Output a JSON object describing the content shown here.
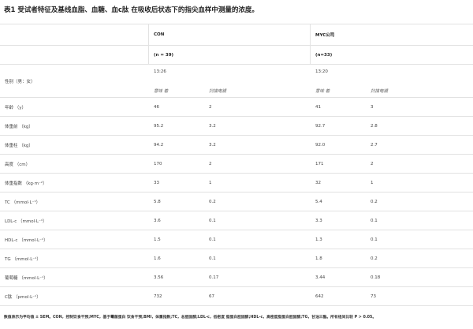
{
  "title": "表1  受试者特征及基线血脂、血糖、血c肽 在吸收后状态下的指尖血样中测量的浓度。",
  "groups": {
    "con": "CON",
    "myc": "MYC公司"
  },
  "n": {
    "con": "(n = 39)",
    "myc": "(n=33)"
  },
  "sex": {
    "label": "性别（男：女）",
    "con": "13:26",
    "myc": "13:20"
  },
  "subheaders": {
    "mean": "意味 着",
    "sem": "扫描电镜"
  },
  "rows": [
    {
      "label": "年龄 （y）",
      "con_mean": "46",
      "con_sem": "2",
      "myc_mean": "41",
      "myc_sem": "3"
    },
    {
      "label": "体重前 （kg）",
      "con_mean": "95.2",
      "con_sem": "3.2",
      "myc_mean": "92.7",
      "myc_sem": "2.8"
    },
    {
      "label": "体重柱 （kg）",
      "con_mean": "94.2",
      "con_sem": "3.2",
      "myc_mean": "92.0",
      "myc_sem": "2.7"
    },
    {
      "label": "高度 （cm）",
      "con_mean": "170",
      "con_sem": "2",
      "myc_mean": "171",
      "myc_sem": "2"
    },
    {
      "label": "体重指数 （kg·m⁻²）",
      "con_mean": "33",
      "con_sem": "1",
      "myc_mean": "32",
      "myc_sem": "1"
    },
    {
      "label": "TC （mmol·L⁻¹）",
      "con_mean": "5.8",
      "con_sem": "0.2",
      "myc_mean": "5.4",
      "myc_sem": "0.2"
    },
    {
      "label": "LDL-c （mmol·L⁻¹）",
      "con_mean": "3.6",
      "con_sem": "0.1",
      "myc_mean": "3.3",
      "myc_sem": "0.1"
    },
    {
      "label": "HDL-c （mmol·L⁻¹）",
      "con_mean": "1.5",
      "con_sem": "0.1",
      "myc_mean": "1.3",
      "myc_sem": "0.1"
    },
    {
      "label": "TG （mmol·L⁻¹）",
      "con_mean": "1.6",
      "con_sem": "0.1",
      "myc_mean": "1.8",
      "myc_sem": "0.2"
    },
    {
      "label": "葡萄糖 （mmol·L⁻¹）",
      "con_mean": "3.56",
      "con_sem": "0.17",
      "myc_mean": "3.44",
      "myc_sem": "0.18"
    },
    {
      "label": "C肽 （pmol·L⁻¹）",
      "con_mean": "732",
      "con_sem": "67",
      "myc_mean": "642",
      "myc_sem": "73"
    }
  ],
  "footnote": "数值表示为平均值 ± SEM。CON，控制饮食干预;MYC，基于霉菌蛋白 饮食干预;BMI，体重指数;TC，总胆固醇;LDL-c，低密度 脂蛋白胆固醇;HDL-c，高密度脂蛋白胆固醇;TG，甘油三酯。所有组间比较 P > 0.05。"
}
